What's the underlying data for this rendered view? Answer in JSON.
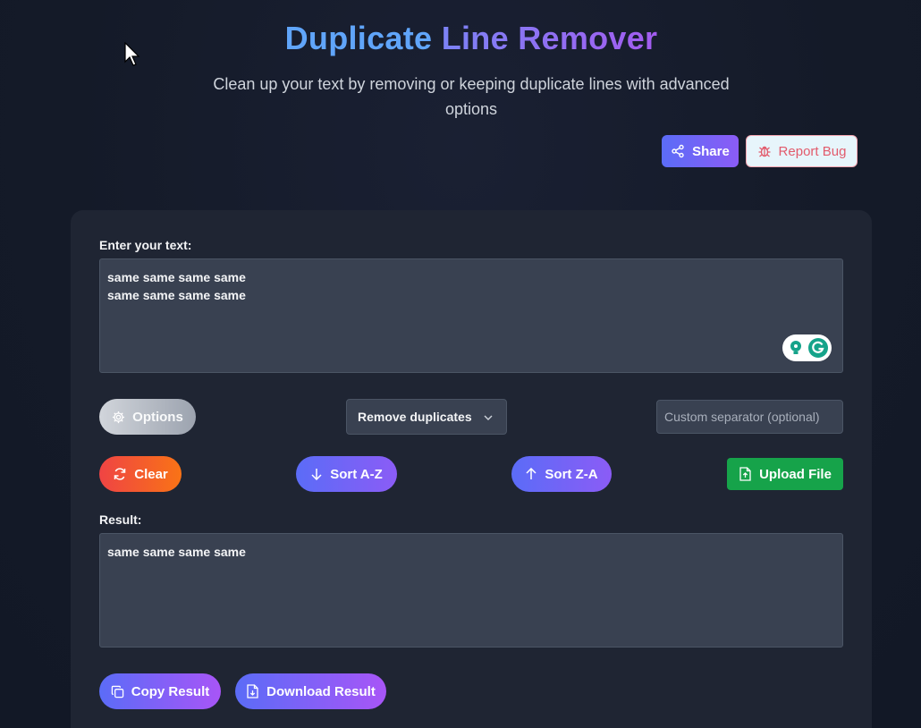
{
  "header": {
    "title_part1": "Duplicate",
    "title_part2": "Line Remover",
    "subtitle": "Clean up your text by removing or keeping duplicate lines with advanced options"
  },
  "actions": {
    "share_label": "Share",
    "report_label": "Report Bug"
  },
  "input": {
    "label": "Enter your text:",
    "value": "same same same same\nsame same same same"
  },
  "controls": {
    "options_label": "Options",
    "mode_selected": "Remove duplicates",
    "separator_placeholder": "Custom separator (optional)",
    "clear_label": "Clear",
    "sort_az_label": "Sort A-Z",
    "sort_za_label": "Sort Z-A",
    "upload_label": "Upload File"
  },
  "result": {
    "label": "Result:",
    "value": "same same same same",
    "copy_label": "Copy Result",
    "download_label": "Download Result"
  },
  "colors": {
    "title_blue": "#60a5fa",
    "accent_purple": "#8b5cf6",
    "upload_green": "#16a34a",
    "clear_red": "#ef4444"
  }
}
